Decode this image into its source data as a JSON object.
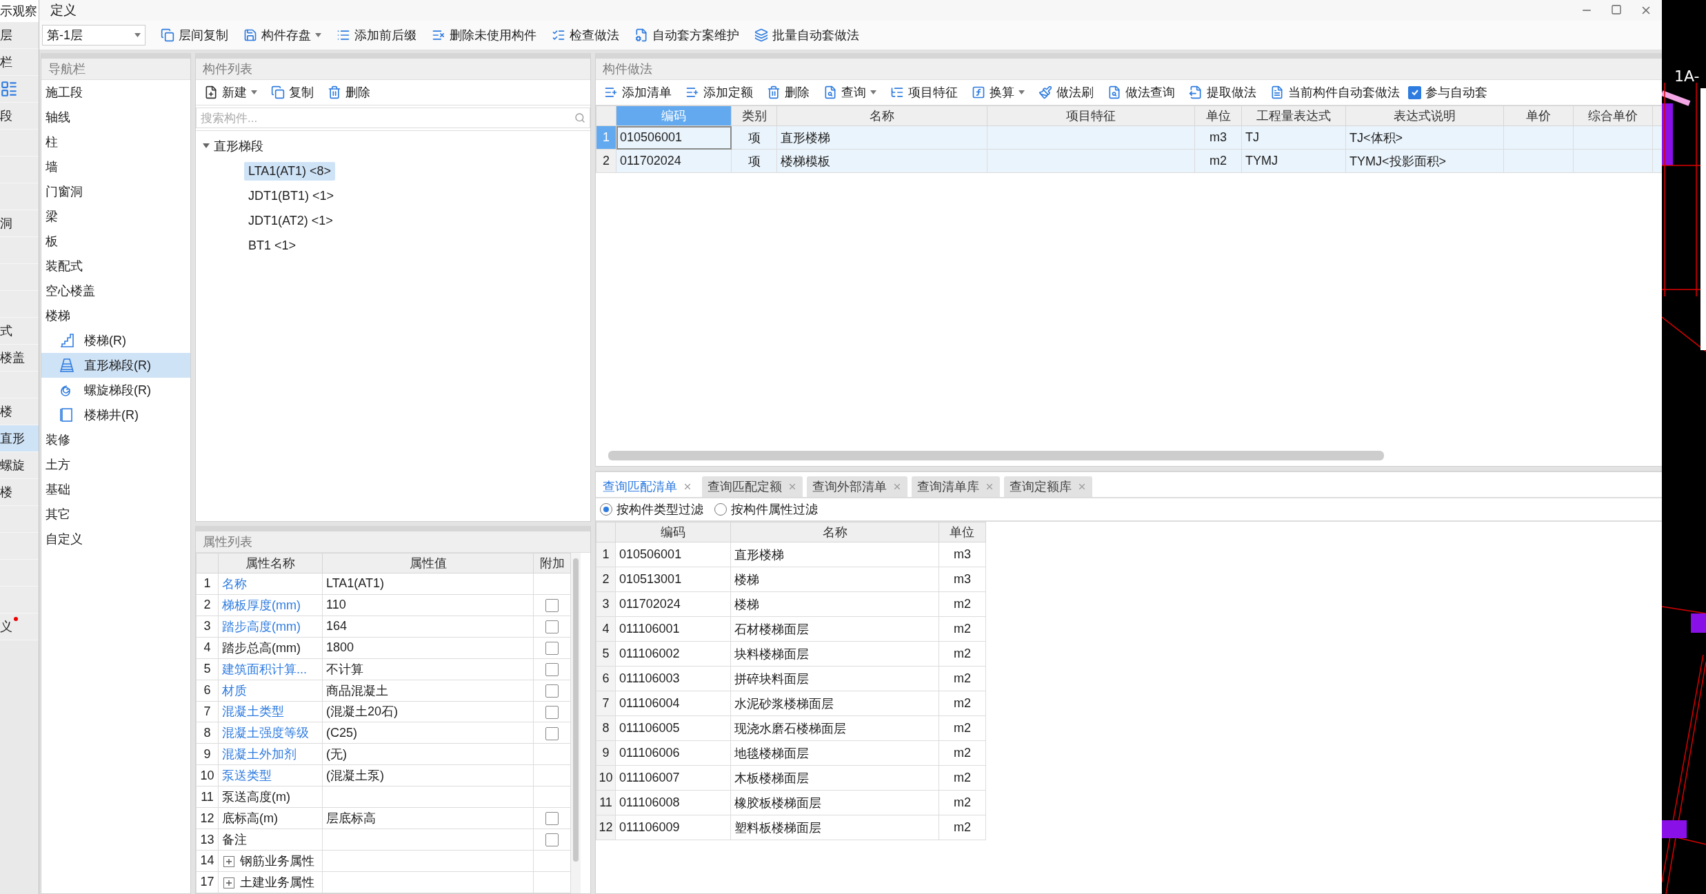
{
  "background_strip": {
    "title": "示观察",
    "rows": [
      {
        "kind": "text",
        "label": "层"
      },
      {
        "kind": "text",
        "label": "栏"
      },
      {
        "kind": "icons"
      },
      {
        "kind": "text",
        "label": "段"
      },
      {
        "kind": "blank"
      },
      {
        "kind": "blank"
      },
      {
        "kind": "blank"
      },
      {
        "kind": "text",
        "label": "洞"
      },
      {
        "kind": "blank"
      },
      {
        "kind": "blank"
      },
      {
        "kind": "blank"
      },
      {
        "kind": "text",
        "label": "式"
      },
      {
        "kind": "text",
        "label": "楼盖"
      },
      {
        "kind": "blank"
      },
      {
        "kind": "text",
        "label": "楼"
      },
      {
        "kind": "text",
        "label": "直形",
        "selected": true
      },
      {
        "kind": "text",
        "label": "螺旋"
      },
      {
        "kind": "text",
        "label": "楼"
      },
      {
        "kind": "blank"
      },
      {
        "kind": "blank"
      },
      {
        "kind": "blank"
      },
      {
        "kind": "blank"
      },
      {
        "kind": "text",
        "label": "义",
        "alert": true
      }
    ]
  },
  "window": {
    "title": "定义"
  },
  "toolbar": {
    "floor_select": "第-1层",
    "buttons": [
      {
        "label": "层间复制",
        "dropdown": false
      },
      {
        "label": "构件存盘",
        "dropdown": true
      },
      {
        "label": "添加前后缀",
        "dropdown": false
      },
      {
        "label": "删除未使用构件",
        "dropdown": false
      },
      {
        "label": "检查做法",
        "dropdown": false
      },
      {
        "label": "自动套方案维护",
        "dropdown": false
      },
      {
        "label": "批量自动套做法",
        "dropdown": false
      }
    ]
  },
  "nav": {
    "title": "导航栏",
    "items": [
      {
        "label": "施工段",
        "selected": false
      },
      {
        "label": "轴线",
        "selected": false
      },
      {
        "label": "柱",
        "selected": false
      },
      {
        "label": "墙",
        "selected": false
      },
      {
        "label": "门窗洞",
        "selected": false
      },
      {
        "label": "梁",
        "selected": false
      },
      {
        "label": "板",
        "selected": false
      },
      {
        "label": "装配式",
        "selected": false
      },
      {
        "label": "空心楼盖",
        "selected": false
      },
      {
        "label": "楼梯",
        "selected": false,
        "children": [
          {
            "label": "楼梯(R)",
            "selected": false
          },
          {
            "label": "直形梯段(R)",
            "selected": true
          },
          {
            "label": "螺旋梯段(R)",
            "selected": false
          },
          {
            "label": "楼梯井(R)",
            "selected": false
          }
        ]
      },
      {
        "label": "装修",
        "selected": false
      },
      {
        "label": "土方",
        "selected": false
      },
      {
        "label": "基础",
        "selected": false
      },
      {
        "label": "其它",
        "selected": false
      },
      {
        "label": "自定义",
        "selected": false
      }
    ]
  },
  "component_list": {
    "title": "构件列表",
    "toolbar": [
      {
        "label": "新建",
        "dropdown": true
      },
      {
        "label": "复制",
        "dropdown": false
      },
      {
        "label": "删除",
        "dropdown": false
      }
    ],
    "search": {
      "placeholder": "搜索构件..."
    },
    "tree": [
      {
        "label": "直形梯段",
        "expanded": true,
        "children": [
          {
            "label": "LTA1(AT1) <8>",
            "selected": true
          },
          {
            "label": "JDT1(BT1) <1>",
            "selected": false
          },
          {
            "label": "JDT1(AT2) <1>",
            "selected": false
          },
          {
            "label": "BT1 <1>",
            "selected": false
          }
        ]
      }
    ]
  },
  "properties": {
    "title": "属性列表",
    "columns": [
      "属性名称",
      "属性值",
      "附加"
    ],
    "rows": [
      {
        "index": "1",
        "name": "名称",
        "value": "LTA1(AT1)",
        "highlighted": true
      },
      {
        "index": "2",
        "name": "梯板厚度(mm)",
        "value": "110",
        "highlighted": true,
        "checked": false
      },
      {
        "index": "3",
        "name": "踏步高度(mm)",
        "value": "164",
        "highlighted": true,
        "checked": false
      },
      {
        "index": "4",
        "name": "踏步总高(mm)",
        "value": "1800",
        "highlighted": false,
        "checked": false
      },
      {
        "index": "5",
        "name": "建筑面积计算...",
        "value": "不计算",
        "highlighted": true,
        "checked": false
      },
      {
        "index": "6",
        "name": "材质",
        "value": "商品混凝土",
        "highlighted": true,
        "checked": false
      },
      {
        "index": "7",
        "name": "混凝土类型",
        "value": "(混凝土20石)",
        "highlighted": true,
        "checked": false
      },
      {
        "index": "8",
        "name": "混凝土强度等级",
        "value": "(C25)",
        "highlighted": true,
        "checked": false
      },
      {
        "index": "9",
        "name": "混凝土外加剂",
        "value": "(无)",
        "highlighted": true
      },
      {
        "index": "10",
        "name": "泵送类型",
        "value": "(混凝土泵)",
        "highlighted": true
      },
      {
        "index": "11",
        "name": "泵送高度(m)",
        "highlighted": false
      },
      {
        "index": "12",
        "name": "底标高(m)",
        "value": "层底标高",
        "highlighted": false,
        "checked": false
      },
      {
        "index": "13",
        "name": "备注",
        "highlighted": false,
        "checked": false
      },
      {
        "index": "14",
        "name": "钢筋业务属性",
        "highlighted": false,
        "expanded": false
      },
      {
        "index": "17",
        "name": "土建业务属性",
        "highlighted": false,
        "expanded": false
      }
    ]
  },
  "methods": {
    "title": "构件做法",
    "toolbar": [
      {
        "label": "添加清单",
        "dropdown": false
      },
      {
        "label": "添加定额",
        "dropdown": false
      },
      {
        "label": "删除",
        "dropdown": false
      },
      {
        "label": "查询",
        "dropdown": true
      },
      {
        "label": "项目特征",
        "dropdown": false
      },
      {
        "label": "换算",
        "dropdown": true
      },
      {
        "label": "做法刷",
        "dropdown": false
      },
      {
        "label": "做法查询",
        "dropdown": false
      },
      {
        "label": "提取做法",
        "dropdown": false
      },
      {
        "label": "当前构件自动套做法",
        "dropdown": false
      }
    ],
    "auto_apply": {
      "label": "参与自动套",
      "checked": true
    },
    "columns": [
      {
        "label": "编码",
        "selected": true
      },
      {
        "label": "类别",
        "selected": false
      },
      {
        "label": "名称",
        "selected": false
      },
      {
        "label": "项目特征",
        "selected": false
      },
      {
        "label": "单位",
        "selected": false
      },
      {
        "label": "工程量表达式",
        "selected": false
      },
      {
        "label": "表达式说明",
        "selected": false
      },
      {
        "label": "单价",
        "selected": false
      },
      {
        "label": "综合单价",
        "selected": false
      }
    ],
    "rows": [
      {
        "index": "1",
        "selected": true,
        "code": "010506001",
        "category": "项",
        "name": "直形楼梯",
        "unit": "m3",
        "expression": "TJ",
        "expression_note": "TJ<体积>"
      },
      {
        "index": "2",
        "selected": false,
        "code": "011702024",
        "category": "项",
        "name": "楼梯模板",
        "unit": "m2",
        "expression": "TYMJ",
        "expression_note": "TYMJ<投影面积>"
      }
    ]
  },
  "query": {
    "tabs": [
      {
        "label": "查询匹配清单",
        "selected": true
      },
      {
        "label": "查询匹配定额",
        "selected": false
      },
      {
        "label": "查询外部清单",
        "selected": false
      },
      {
        "label": "查询清单库",
        "selected": false
      },
      {
        "label": "查询定额库",
        "selected": false
      }
    ],
    "filters": [
      {
        "label": "按构件类型过滤",
        "selected": true
      },
      {
        "label": "按构件属性过滤",
        "selected": false
      }
    ],
    "columns": [
      "编码",
      "名称",
      "单位"
    ],
    "rows": [
      {
        "index": "1",
        "code": "010506001",
        "name": "直形楼梯",
        "unit": "m3"
      },
      {
        "index": "2",
        "code": "010513001",
        "name": "楼梯",
        "unit": "m3"
      },
      {
        "index": "3",
        "code": "011702024",
        "name": "楼梯",
        "unit": "m2"
      },
      {
        "index": "4",
        "code": "011106001",
        "name": "石材楼梯面层",
        "unit": "m2"
      },
      {
        "index": "5",
        "code": "011106002",
        "name": "块料楼梯面层",
        "unit": "m2"
      },
      {
        "index": "6",
        "code": "011106003",
        "name": "拼碎块料面层",
        "unit": "m2"
      },
      {
        "index": "7",
        "code": "011106004",
        "name": "水泥砂浆楼梯面层",
        "unit": "m2"
      },
      {
        "index": "8",
        "code": "011106005",
        "name": "现浇水磨石楼梯面层",
        "unit": "m2"
      },
      {
        "index": "9",
        "code": "011106006",
        "name": "地毯楼梯面层",
        "unit": "m2"
      },
      {
        "index": "10",
        "code": "011106007",
        "name": "木板楼梯面层",
        "unit": "m2"
      },
      {
        "index": "11",
        "code": "011106008",
        "name": "橡胶板楼梯面层",
        "unit": "m2"
      },
      {
        "index": "12",
        "code": "011106009",
        "name": "塑料板楼梯面层",
        "unit": "m2"
      }
    ]
  },
  "canvas": {
    "label": "1A-"
  }
}
